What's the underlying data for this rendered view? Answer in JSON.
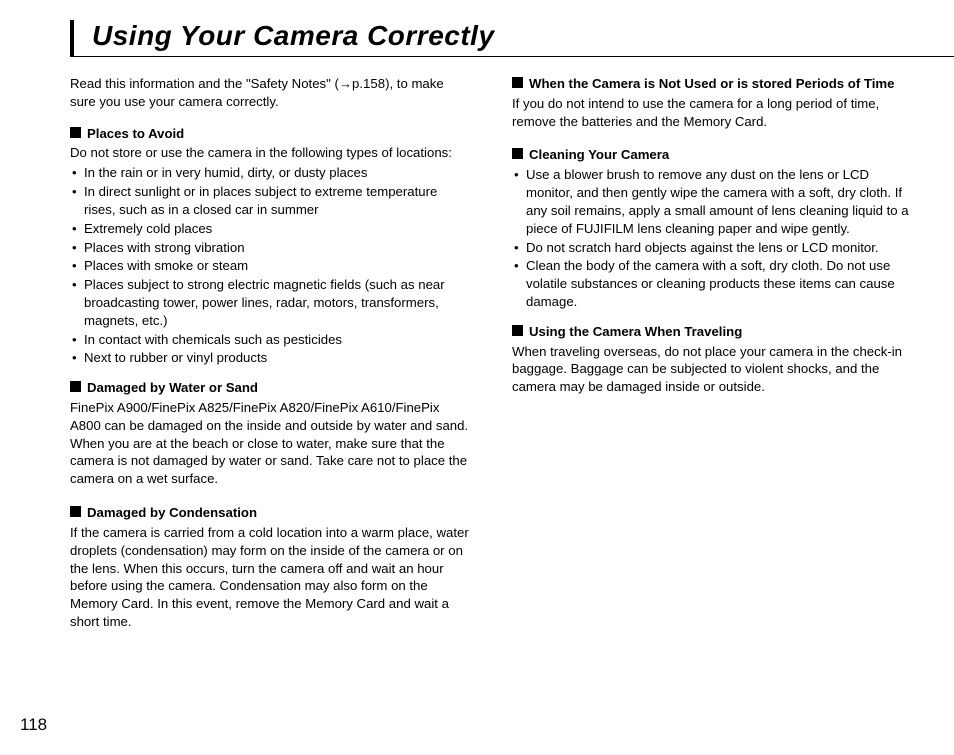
{
  "page_number": "118",
  "title": "Using Your Camera Correctly",
  "intro_1": "Read this information and the \"Safety Notes\" (",
  "intro_ref": "→p.158",
  "intro_2": "), to make sure you use your camera correctly.",
  "left": {
    "s1_head": "Places to Avoid",
    "s1_body": "Do not store or use the camera in the following types of locations:",
    "s1_items": [
      "In the rain or in very humid, dirty, or dusty places",
      "In direct sunlight or in places subject to extreme temperature rises, such as in a closed car in summer",
      "Extremely cold places",
      "Places with strong vibration",
      "Places with smoke or steam",
      "Places subject to strong electric magnetic fields (such as near broadcasting tower, power lines, radar, motors, transformers, magnets, etc.)",
      "In contact with chemicals such as pesticides",
      "Next to rubber or vinyl products"
    ],
    "s2_head": "Damaged by Water or Sand",
    "s2_body": "FinePix A900/FinePix A825/FinePix A820/FinePix A610/FinePix A800 can be damaged on the inside and outside by water and sand. When you are at the beach or close to water, make sure that the camera is not damaged by water or sand. Take care not to place the camera on a wet surface.",
    "s3_head": "Damaged by Condensation",
    "s3_body": "If the camera is carried from a cold location into a warm place, water droplets (condensation) may form on the inside of the camera or on the lens. When this occurs, turn the camera off and wait an hour before using the camera. Condensation may also form on the Memory Card. In this event, remove the Memory Card and wait a short time."
  },
  "right": {
    "s4_head": "When the Camera is Not Used or is stored Periods of Time",
    "s4_body": "If you do not intend to use the camera for a long period of time, remove the batteries and the Memory Card.",
    "s5_head": "Cleaning Your Camera",
    "s5_items": [
      "Use a blower brush to remove any dust on the lens or LCD monitor, and then gently wipe the camera with a soft, dry cloth. If any soil remains, apply a small amount of lens cleaning liquid to a piece of FUJIFILM lens cleaning paper and wipe gently.",
      "Do not scratch hard objects against the lens or LCD monitor.",
      "Clean the body of the camera with a soft, dry cloth. Do not use volatile substances or cleaning products these items can cause damage."
    ],
    "s6_head": "Using the Camera When Traveling",
    "s6_body": "When traveling overseas, do not place your camera in the check-in baggage. Baggage can be subjected to violent shocks, and the camera may be damaged inside or outside."
  }
}
